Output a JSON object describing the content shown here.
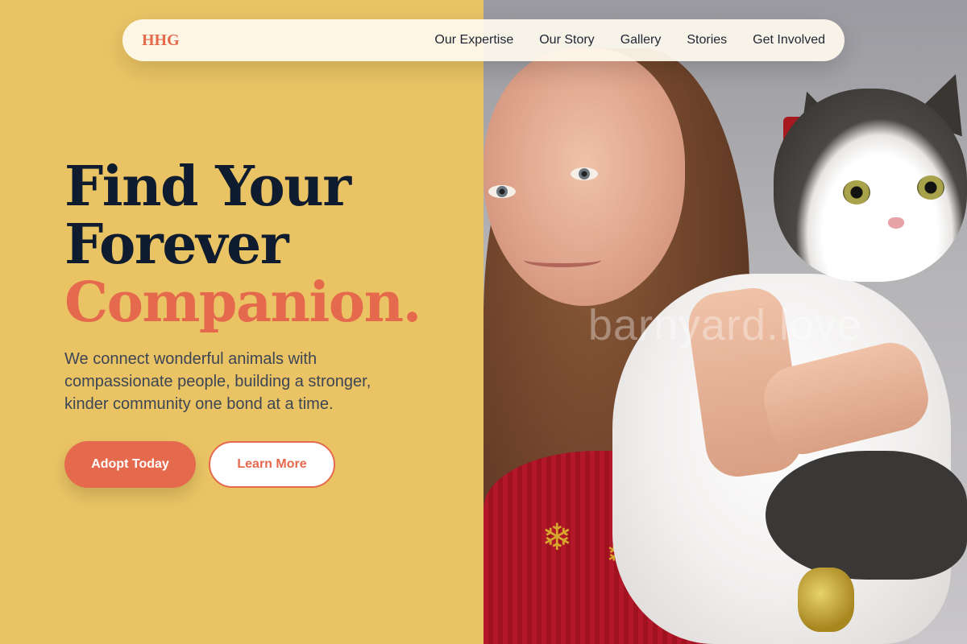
{
  "nav": {
    "logo": "HHG",
    "links": [
      "Our Expertise",
      "Our Story",
      "Gallery",
      "Stories",
      "Get Involved"
    ]
  },
  "hero": {
    "headline_line1": "Find Your",
    "headline_line2": "Forever",
    "headline_accent": "Companion.",
    "subtext": "We connect wonderful animals with compassionate people, building a stronger, kinder community one bond at a time.",
    "primary_button": "Adopt Today",
    "secondary_button": "Learn More"
  },
  "image": {
    "watermark": "barnyard.love"
  },
  "colors": {
    "background": "#EAC464",
    "accent": "#E5694D",
    "heading": "#0F1B2E",
    "body_text": "#3C4555"
  }
}
